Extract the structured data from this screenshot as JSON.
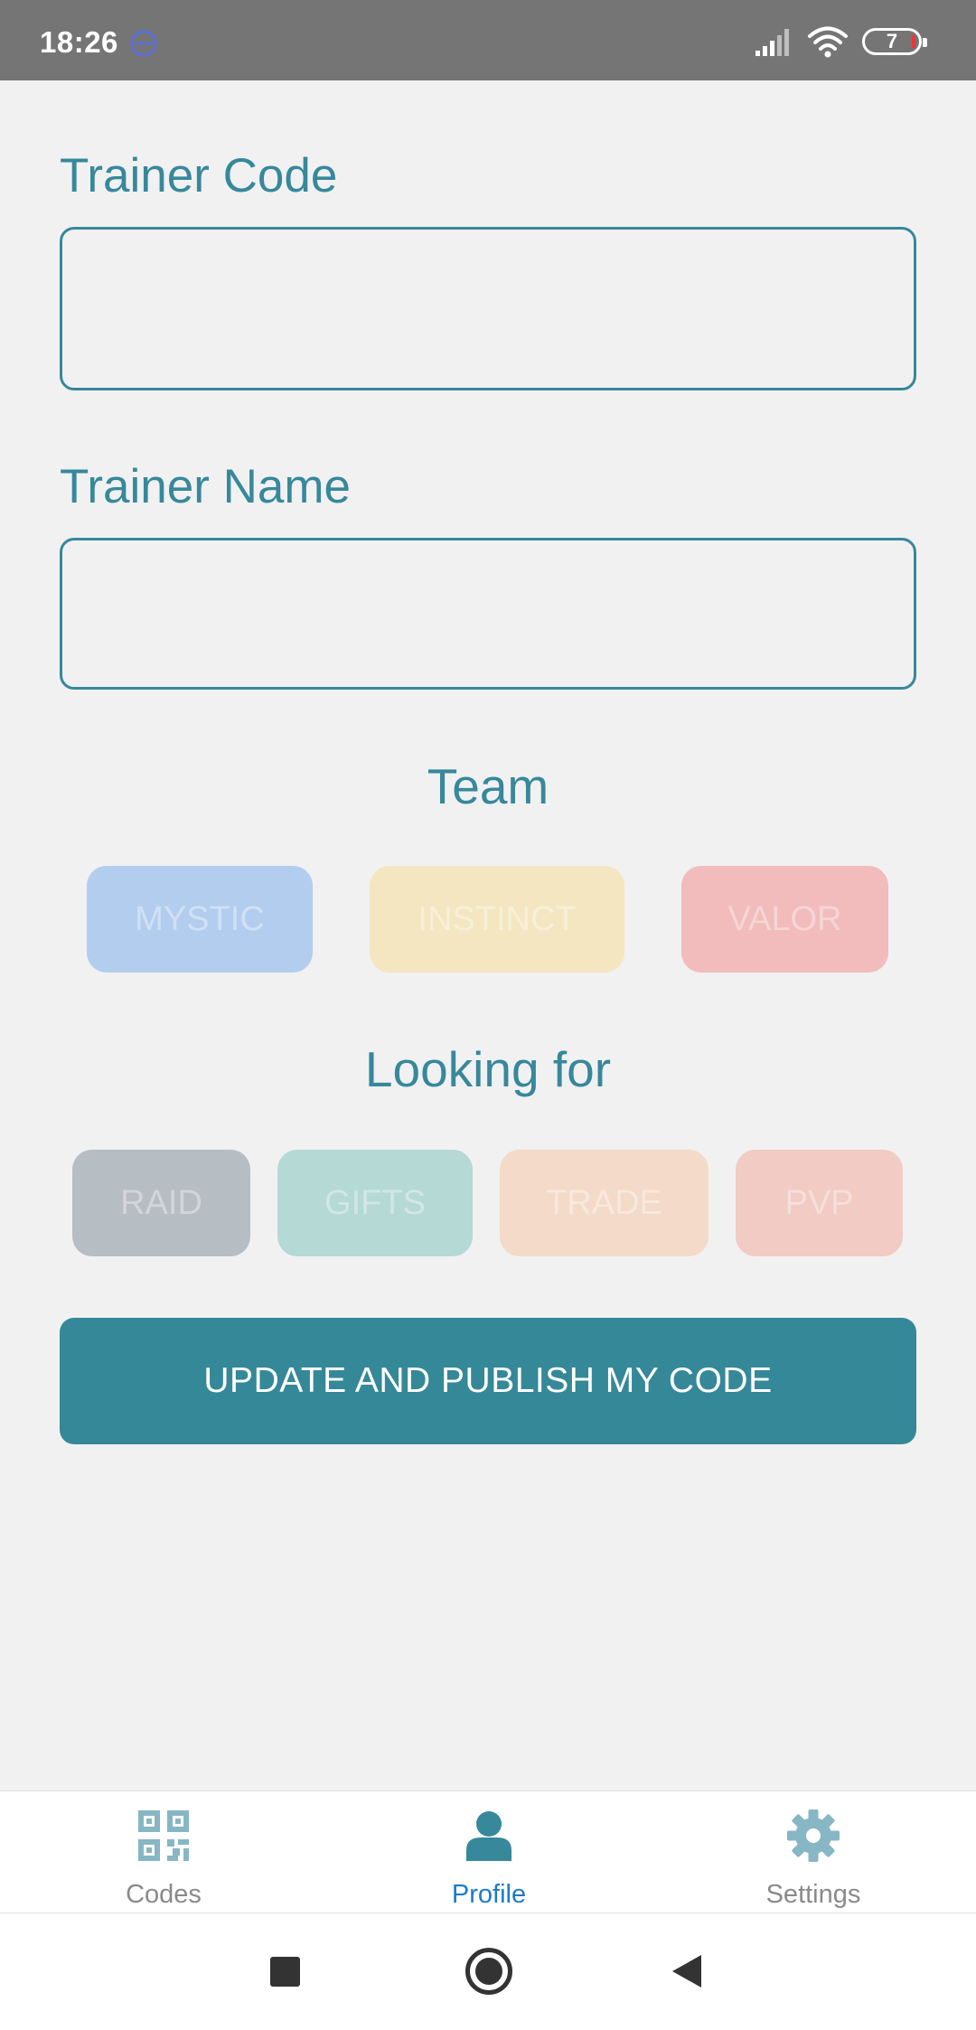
{
  "status_bar": {
    "time": "18:26",
    "battery": "7"
  },
  "form": {
    "trainer_code": {
      "label": "Trainer Code",
      "value": "",
      "placeholder": ""
    },
    "trainer_name": {
      "label": "Trainer Name",
      "value": "",
      "placeholder": ""
    }
  },
  "team": {
    "heading": "Team",
    "options": [
      {
        "label": "MYSTIC",
        "color": "#b3cdef"
      },
      {
        "label": "INSTINCT",
        "color": "#f4e6c0"
      },
      {
        "label": "VALOR",
        "color": "#f1bcbb"
      }
    ]
  },
  "looking_for": {
    "heading": "Looking for",
    "options": [
      {
        "label": "RAID",
        "color": "#b6bdc3"
      },
      {
        "label": "GIFTS",
        "color": "#b5d9d5"
      },
      {
        "label": "TRADE",
        "color": "#f4dac8"
      },
      {
        "label": "PVP",
        "color": "#f1cbc4"
      }
    ]
  },
  "publish_button": {
    "label": "UPDATE AND PUBLISH MY CODE",
    "color": "#358898"
  },
  "bottom_nav": {
    "items": [
      {
        "label": "Codes",
        "icon": "qr-code-icon"
      },
      {
        "label": "Profile",
        "icon": "person-icon",
        "active": true
      },
      {
        "label": "Settings",
        "icon": "gear-icon"
      }
    ]
  },
  "colors": {
    "accent": "#37889a",
    "active_nav": "#1f7ac6",
    "background": "#f1f1f2",
    "status_bar": "#757575"
  }
}
